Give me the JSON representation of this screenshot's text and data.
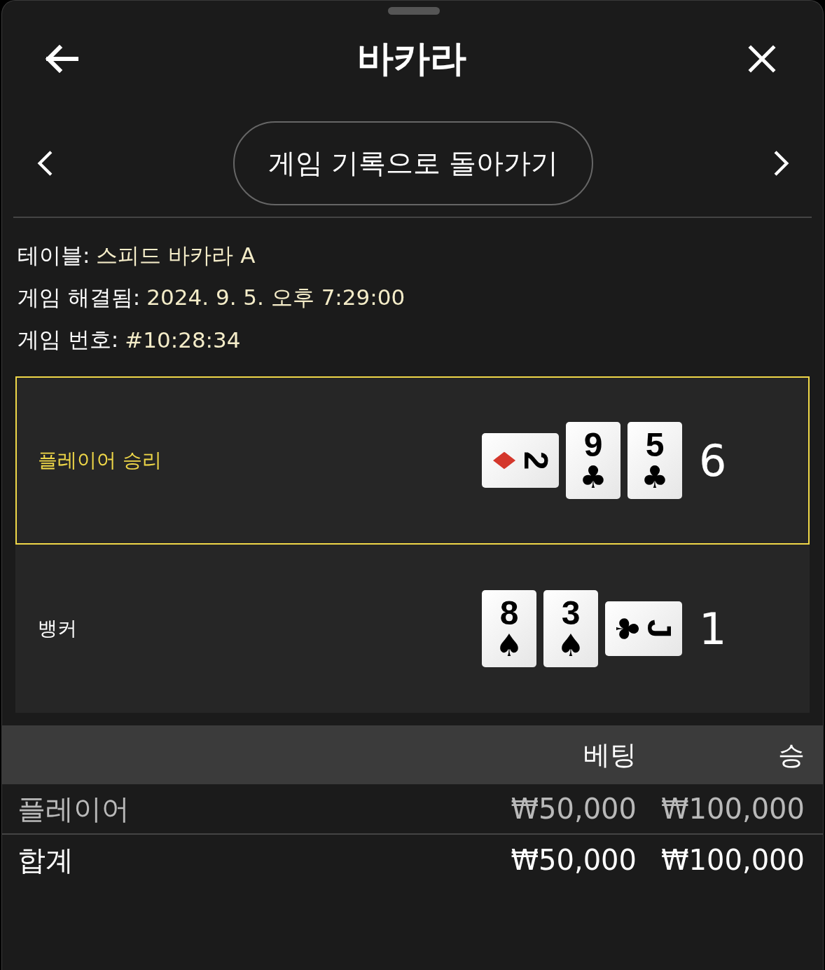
{
  "header": {
    "title": "바카라"
  },
  "nav": {
    "button": "게임 기록으로 돌아가기"
  },
  "info": [
    {
      "label": "테이블:",
      "value": "스피드 바카라 A"
    },
    {
      "label": "게임 해결됨:",
      "value": "2024. 9. 5. 오후 7:29:00"
    },
    {
      "label": "게임 번호:",
      "value": "#10:28:34"
    }
  ],
  "hands": [
    {
      "name": "플레이어 승리",
      "winner": true,
      "score": "6",
      "cards": [
        {
          "rank": "2",
          "suit": "♦",
          "color": "#d4372c",
          "sideways": true
        },
        {
          "rank": "9",
          "suit": "♣",
          "color": "#000000",
          "sideways": false
        },
        {
          "rank": "5",
          "suit": "♣",
          "color": "#000000",
          "sideways": false
        }
      ]
    },
    {
      "name": "뱅커",
      "winner": false,
      "score": "1",
      "cards": [
        {
          "rank": "8",
          "suit": "♠",
          "color": "#000000",
          "sideways": false
        },
        {
          "rank": "3",
          "suit": "♠",
          "color": "#000000",
          "sideways": false
        },
        {
          "rank": "J",
          "suit": "♣",
          "color": "#000000",
          "sideways": true
        }
      ]
    }
  ],
  "bets": {
    "columns": [
      "베팅",
      "승"
    ],
    "rows": [
      {
        "kind": "line",
        "label": "플레이어",
        "bet": "₩50,000",
        "win": "₩100,000"
      },
      {
        "kind": "total",
        "label": "합계",
        "bet": "₩50,000",
        "win": "₩100,000"
      }
    ]
  }
}
